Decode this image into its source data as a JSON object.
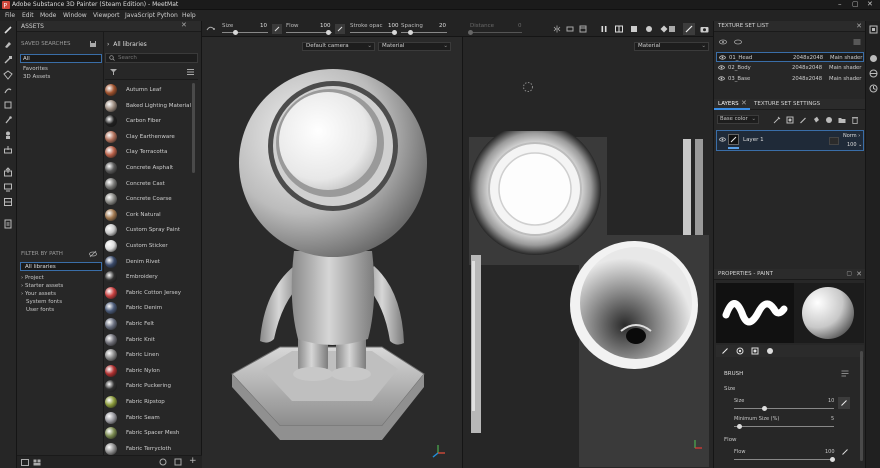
{
  "window": {
    "title": "Adobe Substance 3D Painter (Steam Edition) - MeetMat"
  },
  "menu": [
    "File",
    "Edit",
    "Mode",
    "Window",
    "Viewport",
    "JavaScript",
    "Python",
    "Help"
  ],
  "assets": {
    "header": "ASSETS",
    "breadcrumb": "All libraries",
    "search_placeholder": "Search",
    "saved_searches_label": "SAVED SEARCHES",
    "saved_searches": [
      "All",
      "Favorites",
      "3D Assets"
    ],
    "filter_label": "FILTER BY PATH",
    "filter_tree": [
      "All libraries",
      "Project",
      "Starter assets",
      "Your assets",
      "System fonts",
      "User fonts"
    ],
    "materials": [
      {
        "name": "Autumn Leaf",
        "color": "#a0522d"
      },
      {
        "name": "Baked Lighting Material",
        "color": "#9c8c80"
      },
      {
        "name": "Carbon Fiber",
        "color": "#202020"
      },
      {
        "name": "Clay Earthenware",
        "color": "#b0705a"
      },
      {
        "name": "Clay Terracotta",
        "color": "#b86048"
      },
      {
        "name": "Concrete Asphalt",
        "color": "#5a5a5a"
      },
      {
        "name": "Concrete Cast",
        "color": "#7a7a78"
      },
      {
        "name": "Concrete Coarse",
        "color": "#8a8a86"
      },
      {
        "name": "Cork Natural",
        "color": "#a07850"
      },
      {
        "name": "Custom Spray Paint",
        "color": "#c8c8c8"
      },
      {
        "name": "Custom Sticker",
        "color": "#dcdcdc"
      },
      {
        "name": "Denim Rivet",
        "color": "#3a4a6a"
      },
      {
        "name": "Embroidery",
        "color": "#303030"
      },
      {
        "name": "Fabric Cotton Jersey",
        "color": "#c84040"
      },
      {
        "name": "Fabric Denim",
        "color": "#4a5a78"
      },
      {
        "name": "Fabric Felt",
        "color": "#6a7080"
      },
      {
        "name": "Fabric Knit",
        "color": "#707078"
      },
      {
        "name": "Fabric Linen",
        "color": "#8a8a8a"
      },
      {
        "name": "Fabric Nylon",
        "color": "#b03030"
      },
      {
        "name": "Fabric Puckering",
        "color": "#303030"
      },
      {
        "name": "Fabric Ripstop",
        "color": "#8a9a3a"
      },
      {
        "name": "Fabric Seam",
        "color": "#9a9aa0"
      },
      {
        "name": "Fabric Spacer Mesh",
        "color": "#7a8a50"
      },
      {
        "name": "Fabric Terrycloth",
        "color": "#909090"
      }
    ]
  },
  "toolbar": {
    "size_label": "Size",
    "size_value": "10",
    "flow_label": "Flow",
    "flow_value": "100",
    "stroke_label": "Stroke opac",
    "stroke_value": "100",
    "spacing_label": "Spacing",
    "spacing_value": "20",
    "distance_label": "Distance",
    "distance_value": "0"
  },
  "viewport3d": {
    "camera": "Default camera",
    "channel": "Material"
  },
  "viewport2d": {
    "channel": "Material"
  },
  "texture_set_list": {
    "header": "TEXTURE SET LIST",
    "rows": [
      {
        "name": "01_Head",
        "res": "2048x2048",
        "shader": "Main shader"
      },
      {
        "name": "02_Body",
        "res": "2048x2048",
        "shader": "Main shader"
      },
      {
        "name": "03_Base",
        "res": "2048x2048",
        "shader": "Main shader"
      }
    ]
  },
  "layers": {
    "tab_layers": "LAYERS",
    "tab_settings": "TEXTURE SET SETTINGS",
    "channel": "Base color",
    "layer_name": "Layer 1",
    "blend": "Norm",
    "opacity": "100"
  },
  "properties": {
    "header": "PROPERTIES - PAINT",
    "brush_label": "BRUSH",
    "size_section": "Size",
    "size_label": "Size",
    "size_value": "10",
    "min_size_label": "Minimum Size (%)",
    "min_size_value": "5",
    "flow_section": "Flow",
    "flow_label": "Flow",
    "flow_value": "100"
  }
}
